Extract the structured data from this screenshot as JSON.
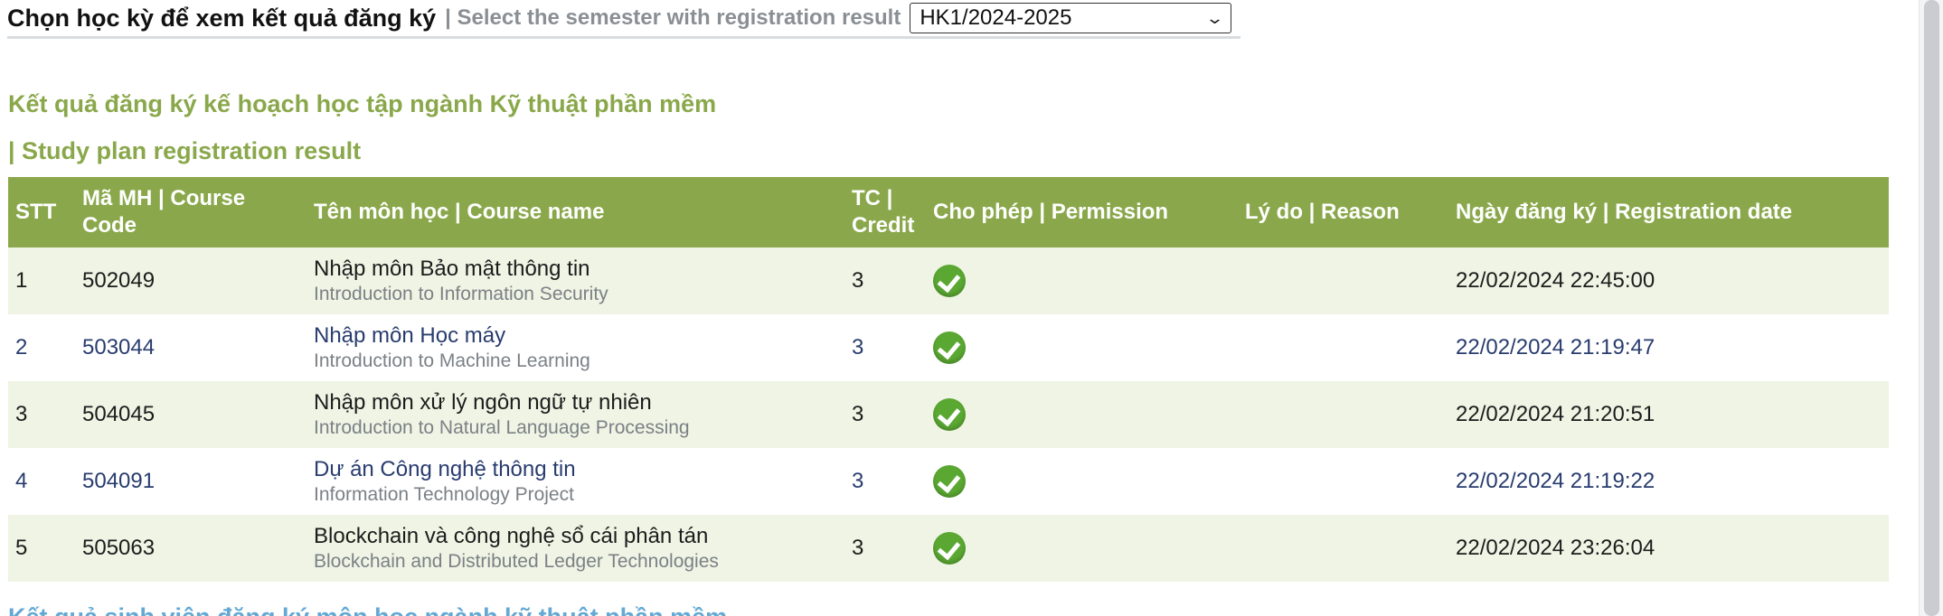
{
  "semester": {
    "label_vi": "Chọn học kỳ để xem kết quả đăng ký",
    "label_en": "| Select the semester with registration result",
    "selected": "HK1/2024-2025"
  },
  "heading": {
    "line1": "Kết quả đăng ký kế hoạch học tập ngành Kỹ thuật phần mềm",
    "line2": "| Study plan registration result"
  },
  "table": {
    "headers": {
      "stt": "STT",
      "code": "Mã MH | Course Code",
      "name": "Tên môn học | Course name",
      "credit": "TC | Credit",
      "permission": "Cho phép | Permission",
      "reason": "Lý do | Reason",
      "date": "Ngày đăng ký | Registration date"
    },
    "rows": [
      {
        "stt": "1",
        "code": "502049",
        "name_vi": "Nhập môn Bảo mật thông tin",
        "name_en": "Introduction to Information Security",
        "credit": "3",
        "reason": "",
        "date": "22/02/2024 22:45:00"
      },
      {
        "stt": "2",
        "code": "503044",
        "name_vi": "Nhập môn Học máy",
        "name_en": "Introduction to Machine Learning",
        "credit": "3",
        "reason": "",
        "date": "22/02/2024 21:19:47"
      },
      {
        "stt": "3",
        "code": "504045",
        "name_vi": "Nhập môn xử lý ngôn ngữ tự nhiên",
        "name_en": "Introduction to Natural Language Processing",
        "credit": "3",
        "reason": "",
        "date": "22/02/2024 21:20:51"
      },
      {
        "stt": "4",
        "code": "504091",
        "name_vi": "Dự án Công nghệ thông tin",
        "name_en": "Information Technology Project",
        "credit": "3",
        "reason": "",
        "date": "22/02/2024 21:19:22"
      },
      {
        "stt": "5",
        "code": "505063",
        "name_vi": "Blockchain và công nghệ sổ cái phân tán",
        "name_en": "Blockchain and Distributed Ledger Technologies",
        "credit": "3",
        "reason": "",
        "date": "22/02/2024 23:26:04"
      }
    ]
  },
  "clipped_heading": "Kết quả sinh viên đăng ký môn học ngành kỹ thuật phần mềm",
  "colors": {
    "header_green": "#8aa84b",
    "row_stripe": "#eff4e4",
    "check_green": "#5aa832",
    "link_blue": "#64a9d3"
  },
  "icons": {
    "permission": "check-circle-icon",
    "select": "chevron-down-icon"
  }
}
